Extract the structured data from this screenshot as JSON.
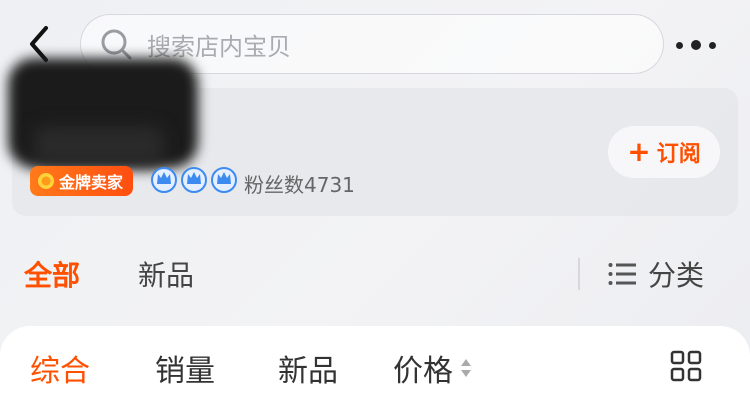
{
  "search": {
    "placeholder": "搜索店内宝贝"
  },
  "shop": {
    "badge": "金牌卖家",
    "fans": "粉丝数4731",
    "subscribe_label": "订阅",
    "crown_count": 3
  },
  "nav": {
    "tabs": [
      {
        "label": "全部",
        "active": true
      },
      {
        "label": "新品",
        "active": false
      }
    ],
    "category_label": "分类"
  },
  "sort": {
    "items": [
      {
        "label": "综合",
        "active": true
      },
      {
        "label": "销量",
        "active": false
      },
      {
        "label": "新品",
        "active": false
      },
      {
        "label": "价格",
        "active": false
      }
    ]
  },
  "colors": {
    "accent": "#ff5000",
    "badge_from": "#ff7a1a",
    "crown": "#3d8bf0"
  },
  "icons": [
    "back-arrow-icon",
    "search-icon",
    "more-dots-icon",
    "medal-icon",
    "crown-icon",
    "plus-icon",
    "menu-list-icon",
    "sort-arrows-icon",
    "grid-view-icon"
  ]
}
